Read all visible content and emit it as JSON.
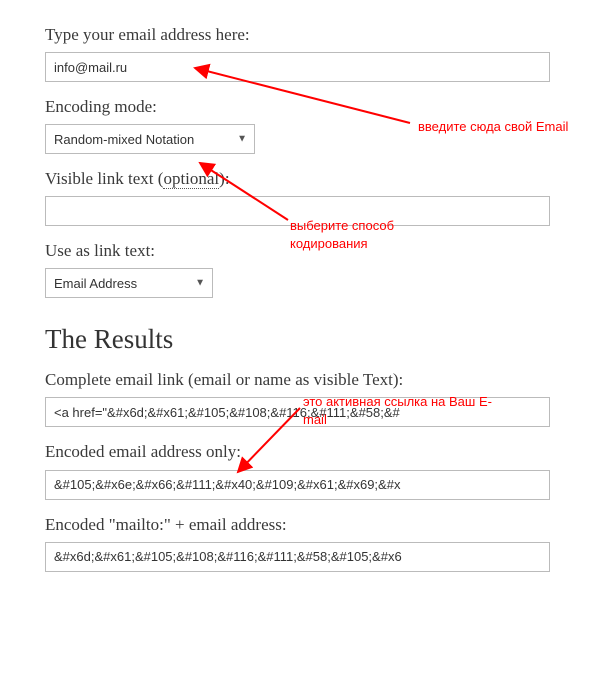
{
  "form": {
    "email_label": "Type your email address here:",
    "email_value": "info@mail.ru",
    "encoding_label": "Encoding mode:",
    "encoding_selected": "Random-mixed Notation",
    "visible_text_label_prefix": "Visible link text (",
    "visible_text_optional": "optional",
    "visible_text_label_suffix": "):",
    "visible_text_value": "",
    "linktext_label": "Use as link text:",
    "linktext_selected": "Email Address"
  },
  "results": {
    "heading": "The Results",
    "complete_label": "Complete email link (email or name as visible Text):",
    "complete_value": "<a href=\"&#x6d;&#x61;&#105;&#108;&#116;&#111;&#58;&#",
    "encoded_email_label": "Encoded email address only:",
    "encoded_email_value": "&#105;&#x6e;&#x66;&#111;&#x40;&#109;&#x61;&#x69;&#x",
    "encoded_mailto_label": "Encoded \"mailto:\" + email address:",
    "encoded_mailto_value": "&#x6d;&#x61;&#105;&#108;&#116;&#111;&#58;&#105;&#x6"
  },
  "annotations": {
    "email_hint": "введите сюда свой Email",
    "encoding_hint": "выберите способ кодирования",
    "results_hint": "это активная ссылка на Ваш E-mail"
  }
}
